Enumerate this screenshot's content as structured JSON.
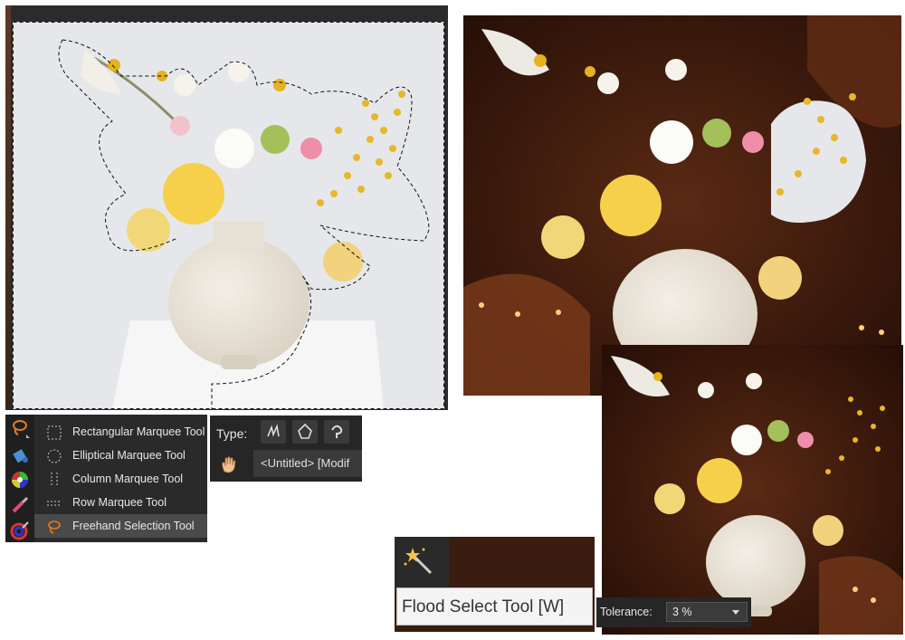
{
  "tools_flyout": {
    "items": [
      {
        "label": "Rectangular Marquee Tool",
        "icon": "rectangle-marquee-icon"
      },
      {
        "label": "Elliptical Marquee Tool",
        "icon": "ellipse-marquee-icon"
      },
      {
        "label": "Column Marquee Tool",
        "icon": "column-marquee-icon"
      },
      {
        "label": "Row Marquee Tool",
        "icon": "row-marquee-icon"
      },
      {
        "label": "Freehand Selection Tool",
        "icon": "lasso-icon",
        "selected": true
      }
    ]
  },
  "toolbar": {
    "icons": [
      "lasso-icon",
      "fill-bucket-icon",
      "color-wheel-icon",
      "brush-icon",
      "gradient-icon"
    ]
  },
  "context_bar": {
    "type_label": "Type:",
    "type_buttons": [
      "freehand-icon",
      "polygonal-icon",
      "magnetic-icon"
    ],
    "document_tab": "<Untitled> [Modif"
  },
  "flood_select": {
    "tooltip": "Flood Select Tool [W]",
    "icon": "magic-wand-icon"
  },
  "tolerance": {
    "label": "Tolerance:",
    "value": "3 %"
  },
  "colors": {
    "panel_dark": "#2a2a2a",
    "selected_item": "#4a4a4a",
    "accent_orange": "#e07b2a",
    "tooltip_bg": "#f4f4f4"
  }
}
